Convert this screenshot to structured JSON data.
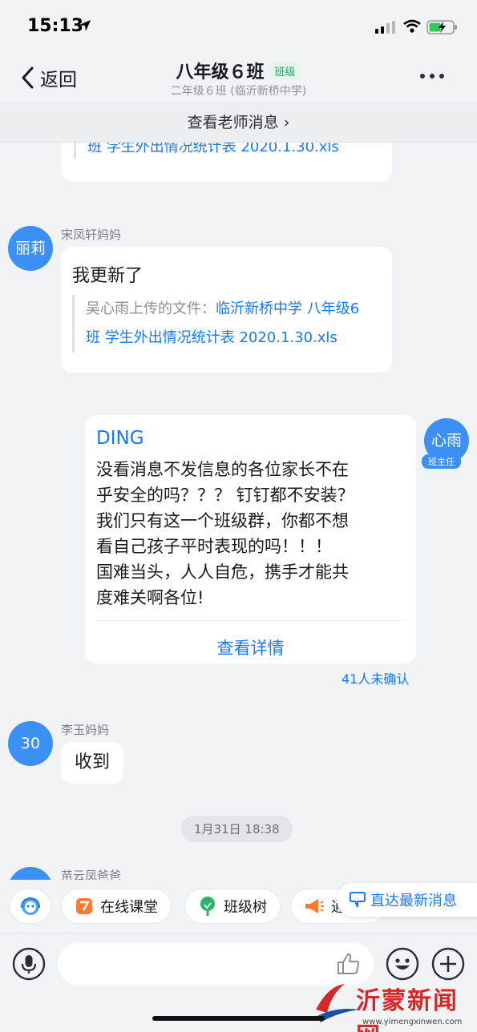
{
  "status_bar": {
    "time": "15:13"
  },
  "nav": {
    "back_label": "返回",
    "title": "八年级６班",
    "badge": "班级",
    "subtitle": "二年级６班 (临沂新桥中学)"
  },
  "teacher_bar": {
    "label": "查看老师消息 ›"
  },
  "messages": {
    "partial_top": {
      "file_text": "班 学生外出情况统计表 2020.1.30.xls"
    },
    "msg1": {
      "sender": "宋凤轩妈妈",
      "avatar_text": "丽莉",
      "text": "我更新了",
      "quote_prefix": "吴心雨上传的文件：",
      "quote_link_1": "临沂新桥中学 八年级6",
      "quote_link_2": "班 学生外出情况统计表 2020.1.30.xls"
    },
    "ding": {
      "avatar_text": "心雨",
      "role": "班主任",
      "title": "DING",
      "line1": "没看消息不发信息的各位家长不在",
      "line2": "乎安全的吗？？？ 钉钉都不安装？",
      "line3": "我们只有这一个班级群，你都不想",
      "line4": "看自己孩子平时表现的吗！！！",
      "line5": "国难当头，人人自危，携手才能共",
      "line6": "度难关啊各位!",
      "detail_label": "查看详情",
      "unconfirmed": "41人未确认"
    },
    "msg2": {
      "sender": "李玉妈妈",
      "avatar_text": "30",
      "text": "收到"
    },
    "time_chip": "1月31日 18:38",
    "msg3_partial": {
      "sender": "苗云凤爸爸"
    }
  },
  "quickbar": {
    "online_class": "在线课堂",
    "class_tree": "班级树",
    "notice_partial": "通",
    "latest_msg": "直达最新消息"
  },
  "watermark": {
    "brand": "沂蒙新闻网",
    "url": "www.yimengxinwen.com"
  },
  "colors": {
    "accent": "#1677ff",
    "avatar": "#3b8ff5",
    "badge_green": "#1ea35c"
  }
}
